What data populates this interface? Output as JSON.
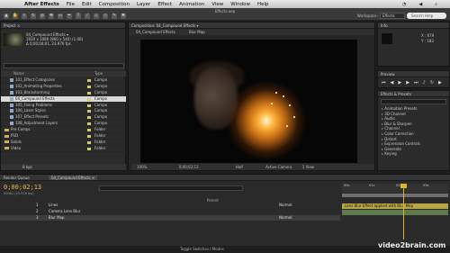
{
  "menubar": {
    "app": "After Effects",
    "items": [
      "File",
      "Edit",
      "Composition",
      "Layer",
      "Effect",
      "Animation",
      "View",
      "Window",
      "Help"
    ],
    "clock": "",
    "status": ""
  },
  "toolbar": {
    "title": "Effects.aep",
    "workspace_label": "Workspace:",
    "workspace_value": "Effects",
    "search_placeholder": "Search Help"
  },
  "project": {
    "tab": "Project ×",
    "comp_name": "04_Compound Effects ▾",
    "comp_info_1": "1920 x 1080 (960 x 540) (1.00)",
    "comp_info_2": "Δ 0;00;04;01, 23.976 fps",
    "col_name": "Name",
    "col_type": "Type",
    "items": [
      {
        "name": "101_Effect Categories",
        "type": "Compo",
        "color": "#d7c86a"
      },
      {
        "name": "102_Animating Properties",
        "type": "Compo",
        "color": "#d7c86a"
      },
      {
        "name": "103_Brainstorming",
        "type": "Compo",
        "color": "#d7c86a"
      },
      {
        "name": "04_Compound Effects",
        "type": "Compo",
        "color": "#d7c86a",
        "selected": true
      },
      {
        "name": "105_Fixing Problems",
        "type": "Compo",
        "color": "#d7c86a"
      },
      {
        "name": "106_Laser Styles",
        "type": "Compo",
        "color": "#d7c86a"
      },
      {
        "name": "107_Effect Presets",
        "type": "Compo",
        "color": "#d7c86a"
      },
      {
        "name": "108_Adjustment Layers",
        "type": "Compo",
        "color": "#d7c86a"
      },
      {
        "name": "Pre-Comps",
        "type": "Folder",
        "color": "#d7c86a",
        "folder": true
      },
      {
        "name": "PSD",
        "type": "Folder",
        "color": "#d7c86a",
        "folder": true
      },
      {
        "name": "Solids",
        "type": "Folder",
        "color": "#d7c86a",
        "folder": true
      },
      {
        "name": "Video",
        "type": "Folder",
        "color": "#d7c86a",
        "folder": true
      }
    ],
    "footer": "8 bpc"
  },
  "viewer": {
    "tab": "Composition: 04_Compound Effects ▾",
    "subtab": "04_Compound Effects",
    "subtab2": "Blur Map",
    "footer_zoom": "100%",
    "footer_time": "0;00;02;13",
    "footer_quality": "Half",
    "footer_camera": "Active Camera",
    "footer_view": "1 View"
  },
  "info_panel": {
    "tab": "Info",
    "x": "X : 679",
    "y": "Y : 183"
  },
  "preview_panel": {
    "tab": "Preview"
  },
  "effects_panel": {
    "tab": "Effects & Presets",
    "items": [
      "Animation Presets",
      "3D Channel",
      "Audio",
      "Blur & Sharpen",
      "Channel",
      "Color Correction",
      "Distort",
      "Expression Controls",
      "Generate",
      "Keying"
    ]
  },
  "timeline": {
    "tabs": [
      "Render Queue",
      "04_Compound Effects ×"
    ],
    "timecode": "0;00;02;13",
    "frames": "00061 (23.976 fps)",
    "layers": [
      {
        "num": "1",
        "name": "Lines",
        "mode": "Normal"
      },
      {
        "num": "2",
        "name": "Camera Lens Blur",
        "mode": ""
      },
      {
        "num": "3",
        "name": "Blur Map",
        "mode": "Normal"
      }
    ],
    "bar_label": "Lens Blur Effect applied with Blur Map",
    "toggle": "Toggle Switches / Modes",
    "parent_label": "Parent",
    "ruler": [
      "00s",
      "01s",
      "02s",
      "03s"
    ]
  },
  "watermark": "video2brain.com"
}
